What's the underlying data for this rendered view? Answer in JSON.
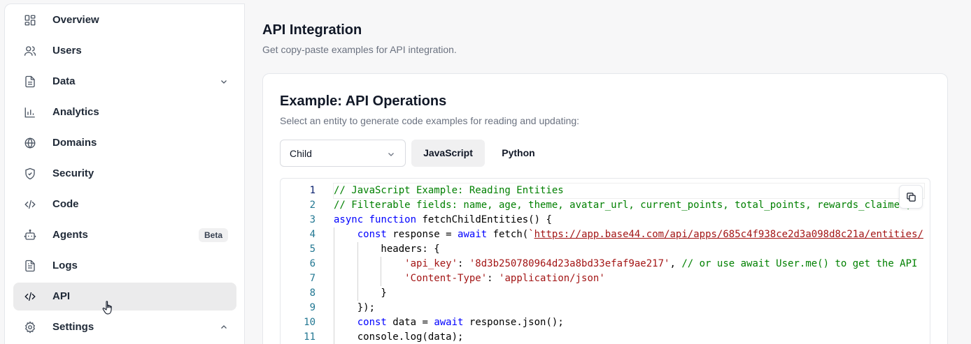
{
  "sidebar": {
    "items": [
      {
        "label": "Overview",
        "icon": "grid-icon"
      },
      {
        "label": "Users",
        "icon": "users-icon"
      },
      {
        "label": "Data",
        "icon": "file-icon",
        "chevron": "down"
      },
      {
        "label": "Analytics",
        "icon": "bar-chart-icon"
      },
      {
        "label": "Domains",
        "icon": "globe-icon"
      },
      {
        "label": "Security",
        "icon": "shield-icon"
      },
      {
        "label": "Code",
        "icon": "code-icon"
      },
      {
        "label": "Agents",
        "icon": "bot-icon",
        "badge": "Beta"
      },
      {
        "label": "Logs",
        "icon": "file-text-icon"
      },
      {
        "label": "API",
        "icon": "code-icon",
        "active": true
      },
      {
        "label": "Settings",
        "icon": "gear-icon",
        "chevron": "up"
      }
    ]
  },
  "main": {
    "title": "API Integration",
    "subtitle": "Get copy-paste examples for API integration.",
    "card": {
      "title": "Example: API Operations",
      "description": "Select an entity to generate code examples for reading and updating:",
      "entity_select": {
        "value": "Child"
      },
      "tabs": [
        {
          "label": "JavaScript",
          "active": true
        },
        {
          "label": "Python",
          "active": false
        }
      ],
      "code": {
        "line_numbers": [
          "1",
          "2",
          "3",
          "4",
          "5",
          "6",
          "7",
          "8",
          "9",
          "10",
          "11"
        ],
        "lines": [
          "// JavaScript Example: Reading Entities",
          "// Filterable fields: name, age, theme, avatar_url, current_points, total_points, rewards_claimed, ",
          "async function fetchChildEntities() {",
          "    const response = await fetch(`https://app.base44.com/api/apps/685c4f938ce2d3a098d8c21a/entities/",
          "        headers: {",
          "            'api_key': '8d3b250780964d23a8bd33efaf9ae217', // or use await User.me() to get the API",
          "            'Content-Type': 'application/json'",
          "        }",
          "    });",
          "    const data = await response.json();",
          "    console.log(data);"
        ]
      }
    }
  },
  "colors": {
    "comment": "#008000",
    "keyword": "#0000ff",
    "string": "#a31515",
    "line_number": "#237893",
    "active_nav_bg": "#ebebec"
  }
}
